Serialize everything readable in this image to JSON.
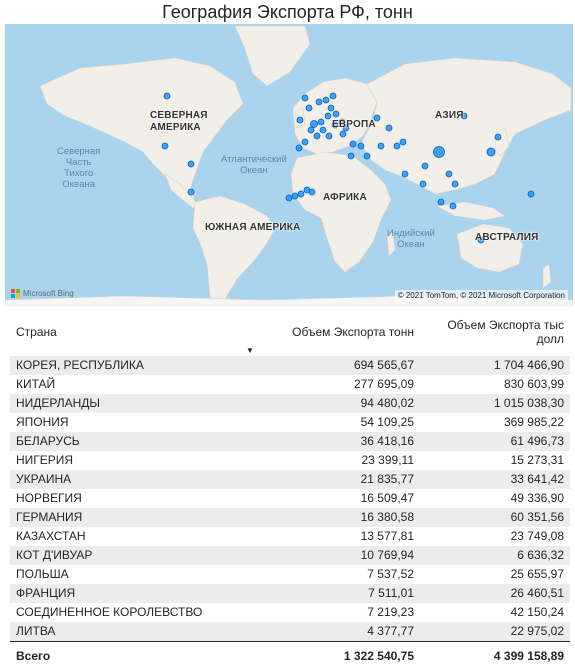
{
  "title": "География Экспорта РФ, тонн",
  "map": {
    "continents": [
      {
        "key": "na",
        "label": "СЕВЕРНАЯ\nАМЕРИКА"
      },
      {
        "key": "eu",
        "label": "ЕВРОПА"
      },
      {
        "key": "as",
        "label": "АЗИЯ"
      },
      {
        "key": "af",
        "label": "АФРИКА"
      },
      {
        "key": "sa",
        "label": "ЮЖНАЯ АМЕРИКА"
      },
      {
        "key": "au",
        "label": "АВСТРАЛИЯ"
      }
    ],
    "oceans": [
      {
        "key": "npo",
        "label": "Северная\nЧасть\nТихого\nОкеана"
      },
      {
        "key": "ato",
        "label": "Атлантический\nОкеан"
      },
      {
        "key": "io",
        "label": "Индийский\nОкеан"
      }
    ],
    "attribution_logo": "Microsoft Bing",
    "copyright": "© 2021 TomTom, © 2021 Microsoft Corporation",
    "bubble_color": "#118dff",
    "land_color": "#f2efe9",
    "water_color": "#aad3ee"
  },
  "table": {
    "columns": [
      "Страна",
      "Объем Экспорта тонн",
      "Объем Экспорта тыс долл"
    ],
    "sort_icon": "sort-descending-icon",
    "rows": [
      [
        "КОРЕЯ, РЕСПУБЛИКА",
        "694 565,67",
        "1 704 466,90"
      ],
      [
        "КИТАЙ",
        "277 695,09",
        "830 603,99"
      ],
      [
        "НИДЕРЛАНДЫ",
        "94 480,02",
        "1 015 038,30"
      ],
      [
        "ЯПОНИЯ",
        "54 109,25",
        "369 985,22"
      ],
      [
        "БЕЛАРУСЬ",
        "36 418,16",
        "61 496,73"
      ],
      [
        "НИГЕРИЯ",
        "23 399,11",
        "15 273,31"
      ],
      [
        "УКРАИНА",
        "21 835,77",
        "33 641,42"
      ],
      [
        "НОРВЕГИЯ",
        "16 509,47",
        "49 336,90"
      ],
      [
        "ГЕРМАНИЯ",
        "16 380,58",
        "60 351,56"
      ],
      [
        "КАЗАХСТАН",
        "13 577,81",
        "23 749,08"
      ],
      [
        "КОТ Д'ИВУАР",
        "10 769,94",
        "6 636,32"
      ],
      [
        "ПОЛЬША",
        "7 537,52",
        "25 655,97"
      ],
      [
        "ФРАНЦИЯ",
        "7 511,01",
        "26 460,51"
      ],
      [
        "СОЕДИНЕННОЕ КОРОЛЕВСТВО",
        "7 219,23",
        "42 150,24"
      ],
      [
        "ЛИТВА",
        "4 377,77",
        "22 975,02"
      ]
    ],
    "total": [
      "Всего",
      "1 322 540,75",
      "4 399 158,89"
    ]
  }
}
